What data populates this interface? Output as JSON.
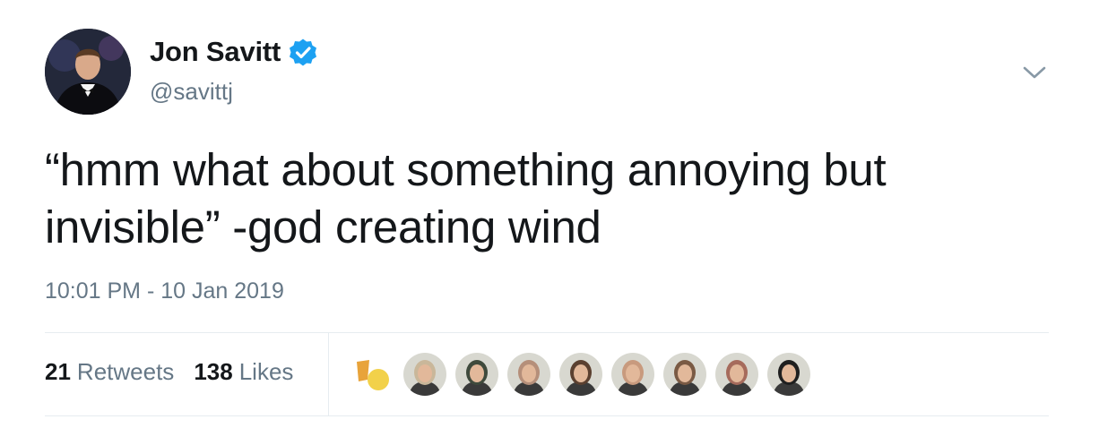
{
  "user": {
    "display_name": "Jon Savitt",
    "handle": "@savittj",
    "verified": true,
    "avatar_icon": "profile-photo-man-in-tuxedo"
  },
  "tweet": {
    "text_line1": "“hmm what about something annoying but",
    "text_line2": "invisible” -god creating wind",
    "timestamp": "10:01 PM - 10 Jan 2019"
  },
  "stats": {
    "retweets_count": "21",
    "retweets_label": "Retweets",
    "likes_count": "138",
    "likes_label": "Likes"
  },
  "likers": [
    {
      "icon": "gday-mate-avatar",
      "color": "#f2d14a"
    },
    {
      "icon": "woman-outdoors-avatar",
      "color": "#c9b79a"
    },
    {
      "icon": "group-photo-avatar",
      "color": "#3f4a3c"
    },
    {
      "icon": "woman-sunglasses-avatar",
      "color": "#b58f7a"
    },
    {
      "icon": "woman-dark-hair-avatar",
      "color": "#5b4030"
    },
    {
      "icon": "woman-curly-hair-avatar",
      "color": "#c89a7e"
    },
    {
      "icon": "woman-smiling-avatar",
      "color": "#7a5a44"
    },
    {
      "icon": "man-sunglasses-avatar",
      "color": "#a66b5c"
    },
    {
      "icon": "woman-black-hair-avatar",
      "color": "#1f1f1f"
    }
  ],
  "colors": {
    "text_primary": "#14171a",
    "text_secondary": "#657786",
    "verified_blue": "#1da1f2",
    "divider": "#e6ecf0"
  }
}
